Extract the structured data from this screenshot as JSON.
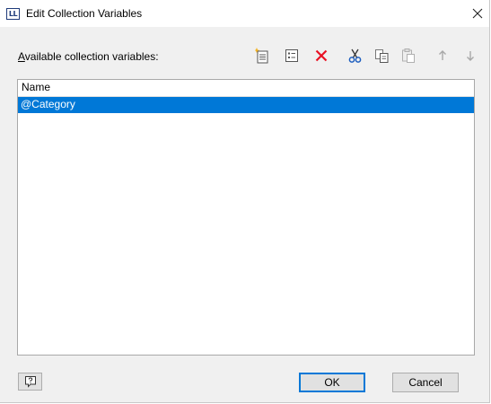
{
  "window": {
    "title": "Edit Collection Variables",
    "close_glyph": "✕",
    "app_icon_text": "LL"
  },
  "toolbar": {
    "label_accel": "A",
    "label_rest": "vailable collection variables:",
    "icons": [
      "new-item-icon",
      "properties-icon",
      "delete-icon",
      "cut-icon",
      "copy-icon",
      "paste-icon",
      "move-up-icon",
      "move-down-icon"
    ]
  },
  "list": {
    "header": "Name",
    "items": [
      {
        "label": "@Category",
        "selected": true
      }
    ]
  },
  "footer": {
    "ok_label": "OK",
    "cancel_label": "Cancel",
    "help_icon": "help-icon"
  },
  "colors": {
    "selection": "#0078d7",
    "delete": "#e81123",
    "accent": "#0078d7"
  }
}
